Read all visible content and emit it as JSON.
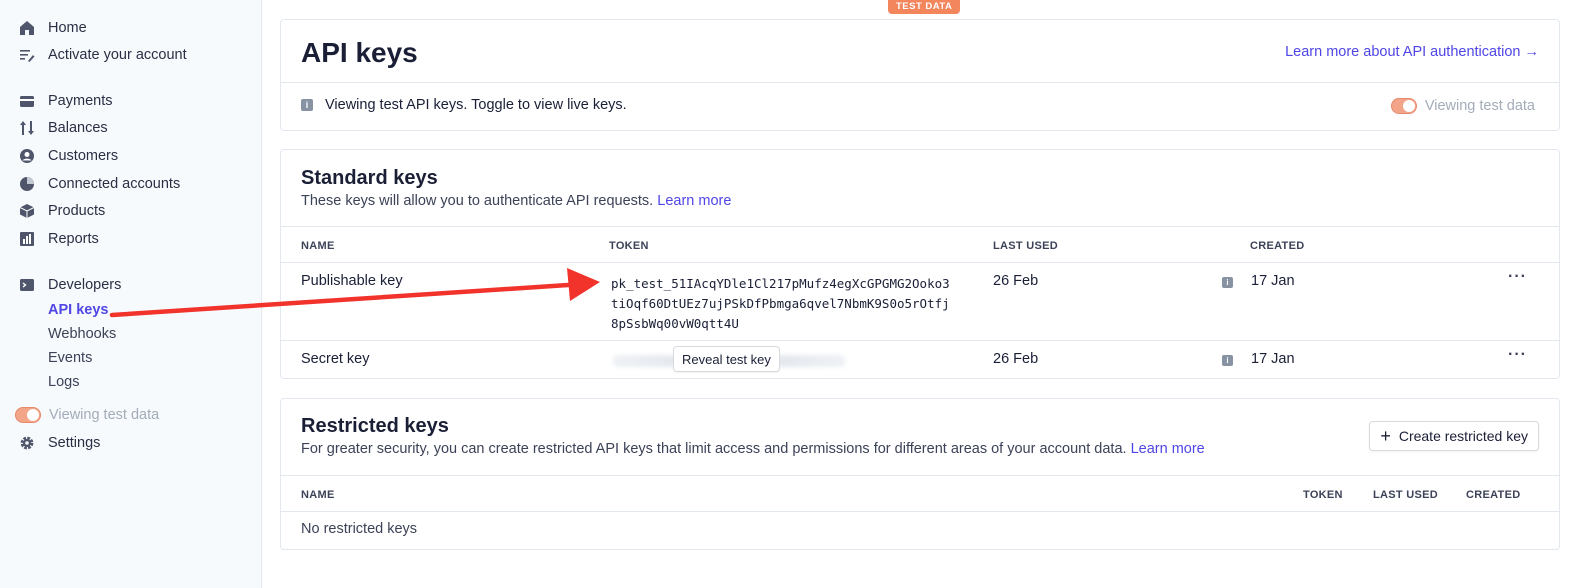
{
  "ribbon": "TEST DATA",
  "sidebar": {
    "items": [
      {
        "label": "Home",
        "icon": "home-icon"
      },
      {
        "label": "Activate your account",
        "icon": "checklist-icon"
      },
      {
        "label": "Payments",
        "icon": "payments-icon"
      },
      {
        "label": "Balances",
        "icon": "balances-icon"
      },
      {
        "label": "Customers",
        "icon": "customers-icon"
      },
      {
        "label": "Connected accounts",
        "icon": "connected-accounts-icon"
      },
      {
        "label": "Products",
        "icon": "products-icon"
      },
      {
        "label": "Reports",
        "icon": "reports-icon"
      },
      {
        "label": "Developers",
        "icon": "developers-icon"
      }
    ],
    "developer_subitems": [
      "API keys",
      "Webhooks",
      "Events",
      "Logs"
    ],
    "toggle_label": "Viewing test data",
    "settings_label": "Settings"
  },
  "header": {
    "title": "API keys",
    "learn_more": "Learn more about API authentication →",
    "info_text": "Viewing test API keys. Toggle to view live keys.",
    "toggle_label": "Viewing test data"
  },
  "standard": {
    "title": "Standard keys",
    "description": "These keys will allow you to authenticate API requests.",
    "learn_more": "Learn more",
    "columns": [
      "NAME",
      "TOKEN",
      "LAST USED",
      "CREATED"
    ],
    "rows": [
      {
        "name": "Publishable key",
        "token": "pk_test_51IAcqYDle1Cl217pMufz4egXcGPGMG2Ooko3tiOqf60DtUEz7ujPSkDfPbmga6qvel7NbmK9S0o5rOtfj8pSsbWq00vW0qtt4U",
        "last_used": "26 Feb",
        "created": "17 Jan"
      },
      {
        "name": "Secret key",
        "reveal": "Reveal test key",
        "last_used": "26 Feb",
        "created": "17 Jan"
      }
    ]
  },
  "restricted": {
    "title": "Restricted keys",
    "description": "For greater security, you can create restricted API keys that limit access and permissions for different areas of your account data.",
    "learn_more": "Learn more",
    "create_button": "Create restricted key",
    "columns": [
      "NAME",
      "TOKEN",
      "LAST USED",
      "CREATED"
    ],
    "empty": "No restricted keys"
  },
  "colors": {
    "accent": "#4f46e5",
    "ribbon": "#f3865c",
    "arrow": "#f2332b"
  }
}
